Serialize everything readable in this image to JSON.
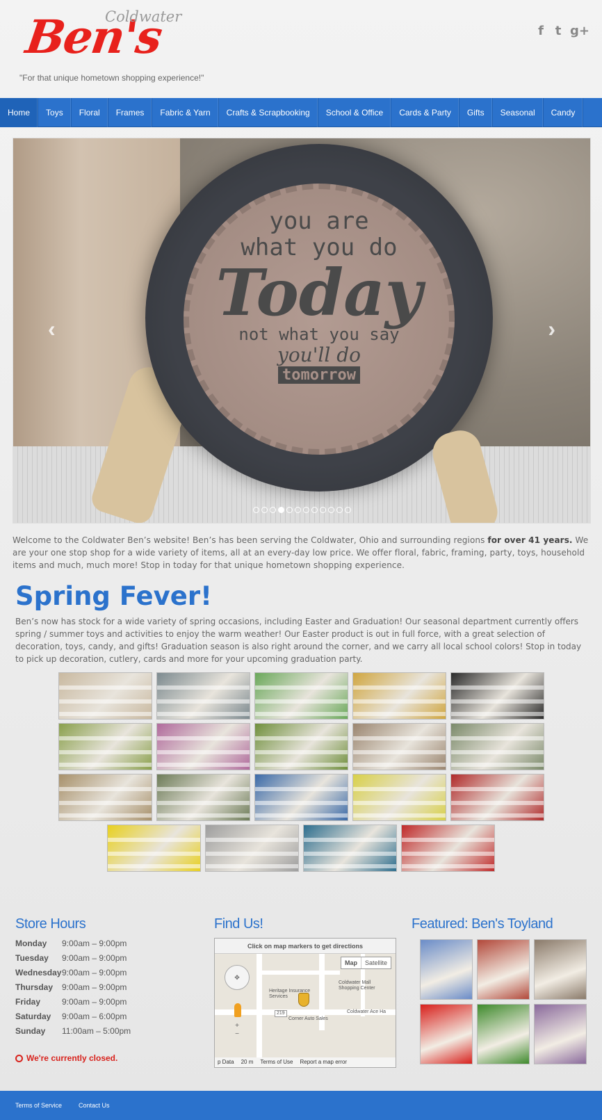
{
  "logo": {
    "sub": "Coldwater",
    "main": "Ben's"
  },
  "tagline": "\"For that unique hometown shopping experience!\"",
  "social": [
    {
      "name": "facebook-icon",
      "glyph": "f"
    },
    {
      "name": "twitter-icon",
      "glyph": "t"
    },
    {
      "name": "google-plus-icon",
      "glyph": "g+"
    }
  ],
  "nav": [
    "Home",
    "Toys",
    "Floral",
    "Frames",
    "Fabric & Yarn",
    "Crafts & Scrapbooking",
    "School & Office",
    "Cards & Party",
    "Gifts",
    "Seasonal",
    "Candy"
  ],
  "slider": {
    "plate_lines": [
      "you are",
      "what you do",
      "Today",
      "not what you say",
      "you'll do",
      "tomorrow"
    ],
    "prev": "‹",
    "next": "›",
    "dot_count": 12,
    "active_dot": 4
  },
  "intro": {
    "before": "Welcome to the Coldwater Ben’s website! Ben’s has been serving the Coldwater, Ohio and surrounding regions ",
    "bold": "for over 41 years.",
    "after": " We are your one stop shop for a wide variety of items, all at an every-day low price. We offer floral, fabric, framing, party, toys, household items and much, much more! Stop in today for that unique hometown shopping experience."
  },
  "spring": {
    "title": "Spring Fever!",
    "text": "Ben’s now has stock for a wide variety of spring occasions, including Easter and Graduation! Our seasonal department currently offers spring / summer toys and activities to enjoy the warm weather! Our Easter product is out in full force, with a great selection of decoration, toys, candy, and gifts! Graduation season is also right around the corner, and we carry all local school colors! Stop in today to pick up decoration, cutlery, cards and more for your upcoming graduation party."
  },
  "gallery_colors": [
    [
      "#c9b9a0",
      "#7c8a8f",
      "#6aa85a",
      "#d0a640",
      "#2b2b2b"
    ],
    [
      "#8aa04c",
      "#b06a9c",
      "#6f8f3c",
      "#9b8670",
      "#7b8a6a"
    ],
    [
      "#a7906a",
      "#6d7c58",
      "#3b6aa8",
      "#d8d048",
      "#b02a2a"
    ],
    [
      "#e8d020",
      "#9e9e9e",
      "#2e6e8e",
      "#c02a2a"
    ]
  ],
  "store_hours": {
    "title": "Store Hours",
    "rows": [
      {
        "day": "Monday",
        "time": "9:00am – 9:00pm"
      },
      {
        "day": "Tuesday",
        "time": "9:00am – 9:00pm"
      },
      {
        "day": "Wednesday",
        "time": "9:00am – 9:00pm"
      },
      {
        "day": "Thursday",
        "time": "9:00am – 9:00pm"
      },
      {
        "day": "Friday",
        "time": "9:00am – 9:00pm"
      },
      {
        "day": "Saturday",
        "time": "9:00am – 6:00pm"
      },
      {
        "day": "Sunday",
        "time": "11:00am – 5:00pm"
      }
    ],
    "status": "We're currently closed."
  },
  "find_us": {
    "title": "Find Us!",
    "header": "Click on map markers to get directions",
    "map_btn": "Map",
    "satellite_btn": "Satellite",
    "labels": [
      "Coldwater Mall Shopping Center",
      "Heritage Insurance Services",
      "Coldwater Ace Ha",
      "Corner Auto Sales",
      "219"
    ],
    "footer": [
      "p Data",
      "20 m",
      "Terms of Use",
      "Report a map error"
    ]
  },
  "featured": {
    "title": "Featured: Ben's Toyland",
    "colors": [
      "#6a8cc8",
      "#b2483a",
      "#8a7a6a",
      "#d8201c",
      "#3e8a2c",
      "#8a6a9c"
    ]
  },
  "footer": {
    "links": [
      "Terms of Service",
      "Contact Us"
    ]
  }
}
